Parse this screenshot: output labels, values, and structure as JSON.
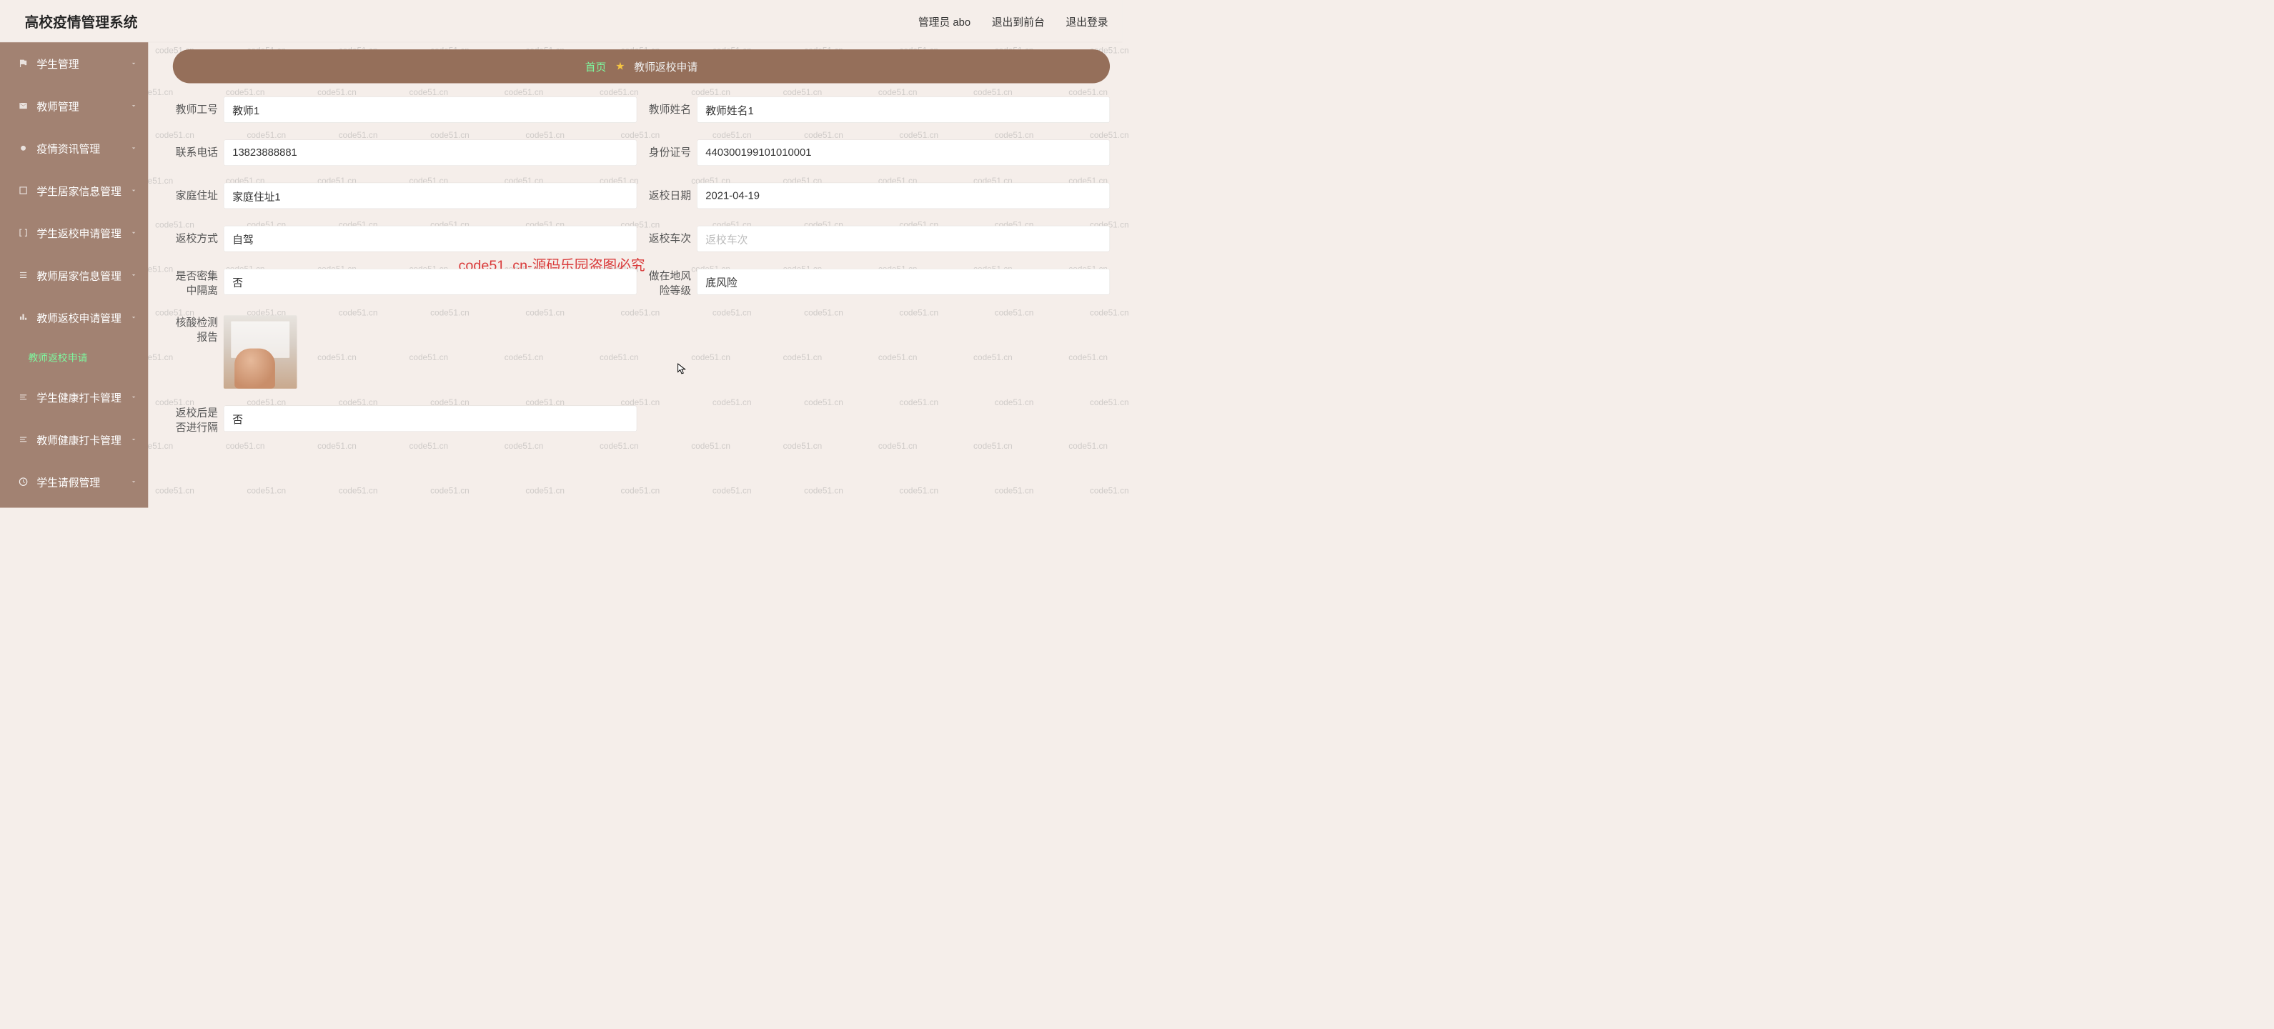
{
  "header": {
    "brand": "高校疫情管理系统",
    "user_label": "管理员 abo",
    "logout_front": "退出到前台",
    "logout": "退出登录"
  },
  "sidebar": {
    "items": [
      {
        "label": "学生管理",
        "icon": "flag-icon",
        "expandable": true
      },
      {
        "label": "教师管理",
        "icon": "mail-icon",
        "expandable": true
      },
      {
        "label": "疫情资讯管理",
        "icon": "dot-icon",
        "expandable": true
      },
      {
        "label": "学生居家信息管理",
        "icon": "square-icon",
        "expandable": true
      },
      {
        "label": "学生返校申请管理",
        "icon": "brackets-icon",
        "expandable": true
      },
      {
        "label": "教师居家信息管理",
        "icon": "list-icon",
        "expandable": true
      },
      {
        "label": "教师返校申请管理",
        "icon": "bars-icon",
        "expandable": true
      },
      {
        "label": "教师返校申请",
        "icon": "",
        "sub": true
      },
      {
        "label": "学生健康打卡管理",
        "icon": "lines-icon",
        "expandable": true
      },
      {
        "label": "教师健康打卡管理",
        "icon": "lines-icon",
        "expandable": true
      },
      {
        "label": "学生请假管理",
        "icon": "clock-icon",
        "expandable": true
      }
    ]
  },
  "tabs": {
    "home": "首页",
    "current": "教师返校申请"
  },
  "form": {
    "teacher_id": {
      "label": "教师工号",
      "value": "教师1"
    },
    "teacher_name": {
      "label": "教师姓名",
      "value": "教师姓名1"
    },
    "phone": {
      "label": "联系电话",
      "value": "13823888881"
    },
    "id_no": {
      "label": "身份证号",
      "value": "440300199101010001"
    },
    "home_addr": {
      "label": "家庭住址",
      "value": "家庭住址1"
    },
    "return_date": {
      "label": "返校日期",
      "value": "2021-04-19"
    },
    "return_method": {
      "label": "返校方式",
      "value": "自驾"
    },
    "return_train": {
      "label": "返校车次",
      "placeholder": "返校车次"
    },
    "is_dense_line1": "是否密集",
    "is_dense_line2": "中隔离",
    "is_dense_value": "否",
    "risk_line1": "做在地风",
    "risk_line2": "险等级",
    "risk_value": "底风险",
    "nat_line1": "核酸检测",
    "nat_line2": "报告",
    "after_return_line1": "返校后是",
    "after_return_line2": "否进行隔",
    "after_return_value": "否"
  },
  "watermark": "code51.cn",
  "center_watermark": "code51. cn-源码乐园盗图必究"
}
